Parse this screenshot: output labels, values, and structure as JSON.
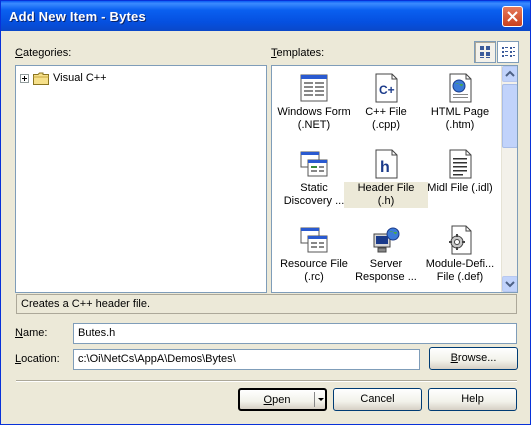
{
  "window": {
    "title": "Add New Item - Bytes"
  },
  "categories": {
    "label_u": "C",
    "label_rest": "ategories:",
    "tree": [
      {
        "label": "Visual C++",
        "expander": "plus",
        "icon": "folder-icon"
      }
    ]
  },
  "templates": {
    "label_u": "T",
    "label_rest": "emplates:",
    "view_buttons": [
      {
        "icon": "large-icons-view-icon",
        "active": true
      },
      {
        "icon": "small-icons-view-icon",
        "active": false
      }
    ],
    "items": [
      {
        "line1": "Windows Form",
        "line2": "(.NET)",
        "icon": "windows-form-icon"
      },
      {
        "line1": "C++ File",
        "line2": "(.cpp)",
        "icon": "cpp-file-icon"
      },
      {
        "line1": "HTML Page",
        "line2": "(.htm)",
        "icon": "html-page-icon"
      },
      {
        "line1": "Static",
        "line2": "Discovery ...",
        "icon": "static-discovery-icon"
      },
      {
        "line1": "Header File",
        "line2": "(.h)",
        "icon": "header-file-icon",
        "selected": true
      },
      {
        "line1": "Midl File (.idl)",
        "line2": "",
        "icon": "midl-file-icon"
      },
      {
        "line1": "Resource File",
        "line2": "(.rc)",
        "icon": "resource-file-icon"
      },
      {
        "line1": "Server",
        "line2": "Response ...",
        "icon": "server-response-icon"
      },
      {
        "line1": "Module-Defi...",
        "line2": "File (.def)",
        "icon": "module-definition-icon"
      }
    ]
  },
  "description": "Creates a C++ header file.",
  "name_field": {
    "label_u": "N",
    "label_rest": "ame:",
    "value": "Butes.h"
  },
  "location_field": {
    "label_u": "L",
    "label_rest": "ocation:",
    "value": "c:\\Oi\\NetCs\\AppA\\Demos\\Bytes\\"
  },
  "buttons": {
    "browse_u": "B",
    "browse_rest": "rowse...",
    "open_u": "O",
    "open_rest": "pen",
    "cancel": "Cancel",
    "help": "Help"
  },
  "colors": {
    "title_bar": "#0a5cf4",
    "dialog_bg": "#ece9d8",
    "field_border": "#7f9db9"
  }
}
